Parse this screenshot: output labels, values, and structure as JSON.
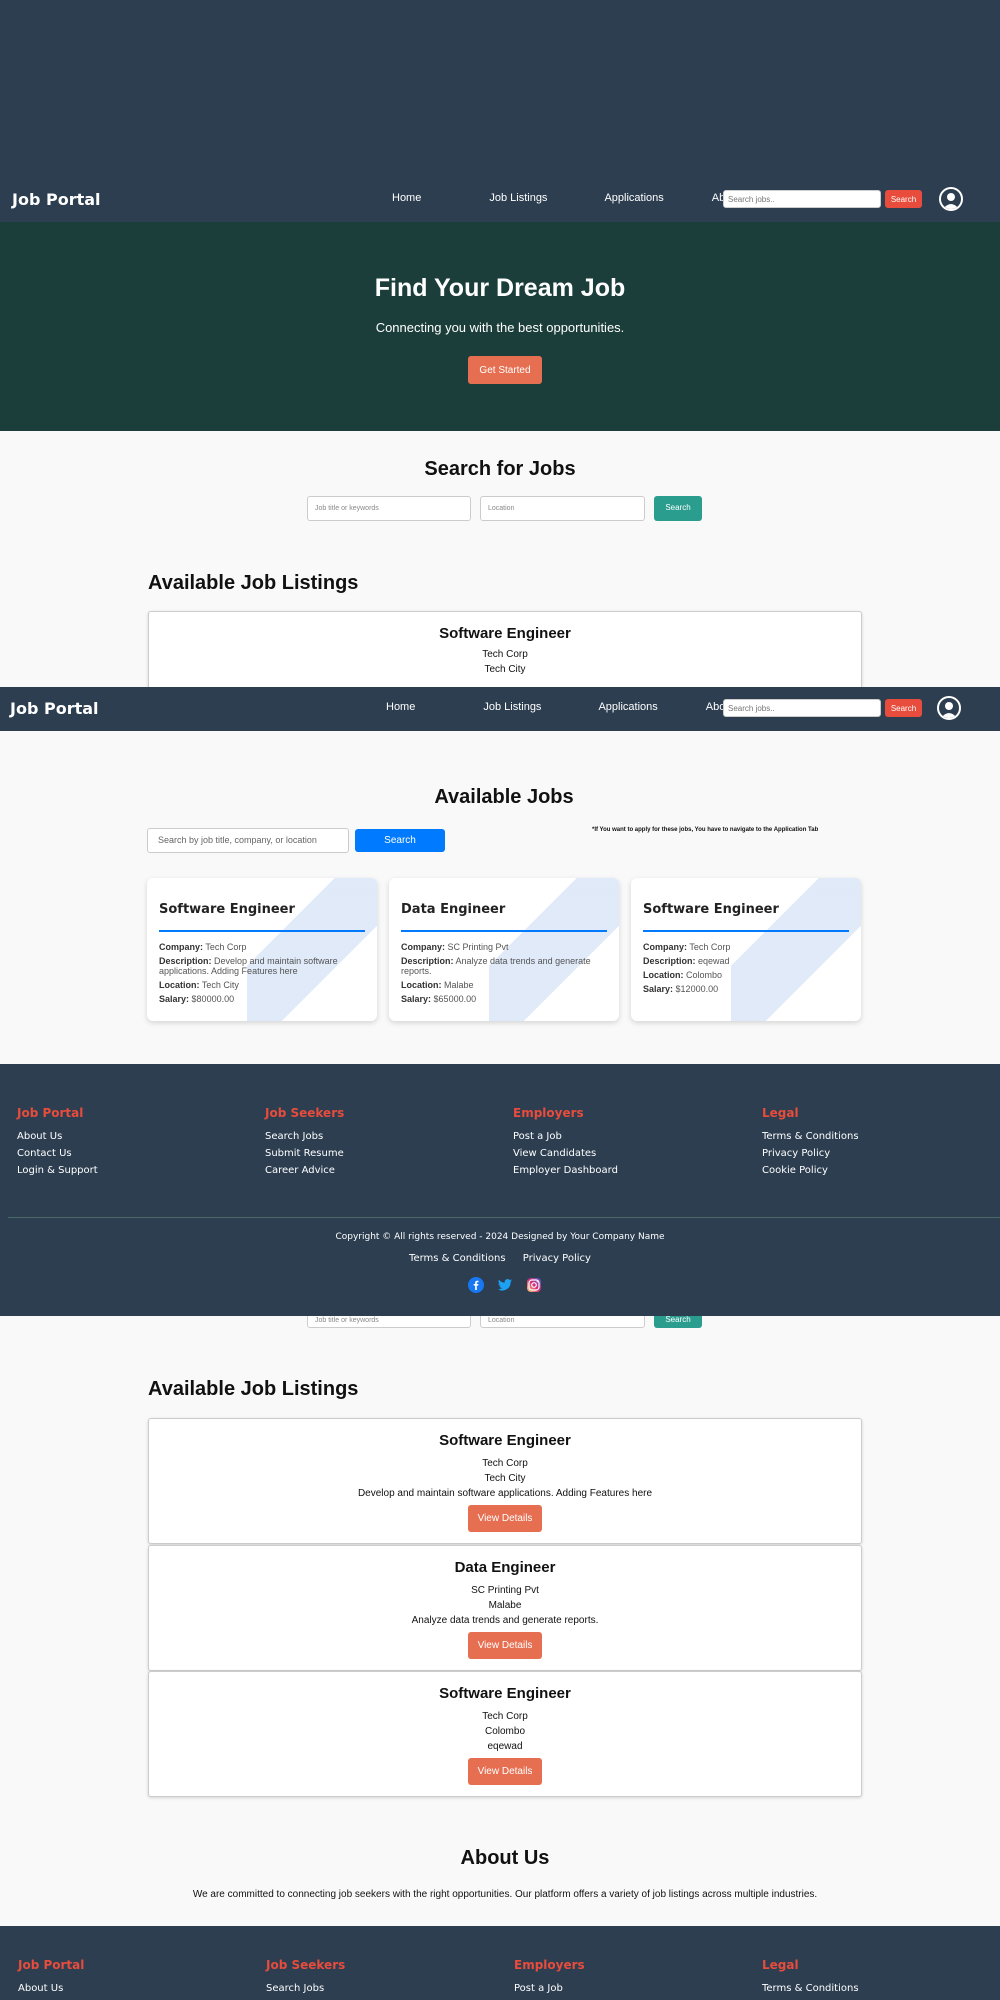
{
  "nav": {
    "logo": "Job Portal",
    "links": [
      "Home",
      "Job Listings",
      "Applications",
      "About Us"
    ],
    "search_placeholder": "Search jobs..",
    "search_label": "Search"
  },
  "hero": {
    "title": "Find Your Dream Job",
    "subtitle": "Connecting you with the best opportunities.",
    "cta": "Get Started"
  },
  "search_section": {
    "title": "Search for Jobs",
    "keyword_placeholder": "Job title or keywords",
    "location_placeholder": "Location",
    "button": "Search"
  },
  "listings": {
    "title": "Available Job Listings",
    "view_label": "View Details",
    "jobs": [
      {
        "title": "Software Engineer",
        "company": "Tech Corp",
        "location": "Tech City",
        "description": "Develop and maintain software applications. Adding Features here"
      },
      {
        "title": "Data Engineer",
        "company": "SC Printing Pvt",
        "location": "Malabe",
        "description": "Analyze data trends and generate reports."
      },
      {
        "title": "Software Engineer",
        "company": "Tech Corp",
        "location": "Colombo",
        "description": "eqewad"
      }
    ]
  },
  "available_jobs": {
    "title": "Available Jobs",
    "search_placeholder": "Search by job title, company, or location",
    "search_button": "Search",
    "note": "*If You want to apply for these jobs, You have to navigate to the Application Tab",
    "labels": {
      "company": "Company:",
      "description": "Description:",
      "location": "Location:",
      "salary": "Salary:"
    },
    "cards": [
      {
        "title": "Software Engineer",
        "company": "Tech Corp",
        "description": "Develop and maintain software applications. Adding Features here",
        "location": "Tech City",
        "salary": "$80000.00"
      },
      {
        "title": "Data Engineer",
        "company": "SC Printing Pvt",
        "description": "Analyze data trends and generate reports.",
        "location": "Malabe",
        "salary": "$65000.00"
      },
      {
        "title": "Software Engineer",
        "company": "Tech Corp",
        "description": "eqewad",
        "location": "Colombo",
        "salary": "$12000.00"
      }
    ]
  },
  "footer": {
    "columns": [
      {
        "heading": "Job Portal",
        "links": [
          "About Us",
          "Contact Us",
          "Login & Support"
        ]
      },
      {
        "heading": "Job Seekers",
        "links": [
          "Search Jobs",
          "Submit Resume",
          "Career Advice"
        ]
      },
      {
        "heading": "Employers",
        "links": [
          "Post a Job",
          "View Candidates",
          "Employer Dashboard"
        ]
      },
      {
        "heading": "Legal",
        "links": [
          "Terms & Conditions",
          "Privacy Policy",
          "Cookie Policy"
        ]
      }
    ],
    "copyright": "Copyright © All rights reserved - 2024 Designed by Your Company Name",
    "bottom_links": [
      "Terms & Conditions",
      "Privacy Policy"
    ],
    "social_icons": [
      "facebook-icon",
      "twitter-icon",
      "instagram-icon"
    ]
  },
  "about": {
    "title": "About Us",
    "text": "We are committed to connecting job seekers with the right opportunities. Our platform offers a variety of job listings across multiple industries."
  },
  "colors": {
    "navy": "#2c3e50",
    "hero": "#1b3e3b",
    "accent": "#e76f51",
    "red": "#e74c3c",
    "teal": "#2a9d8f",
    "blue": "#007bff"
  }
}
